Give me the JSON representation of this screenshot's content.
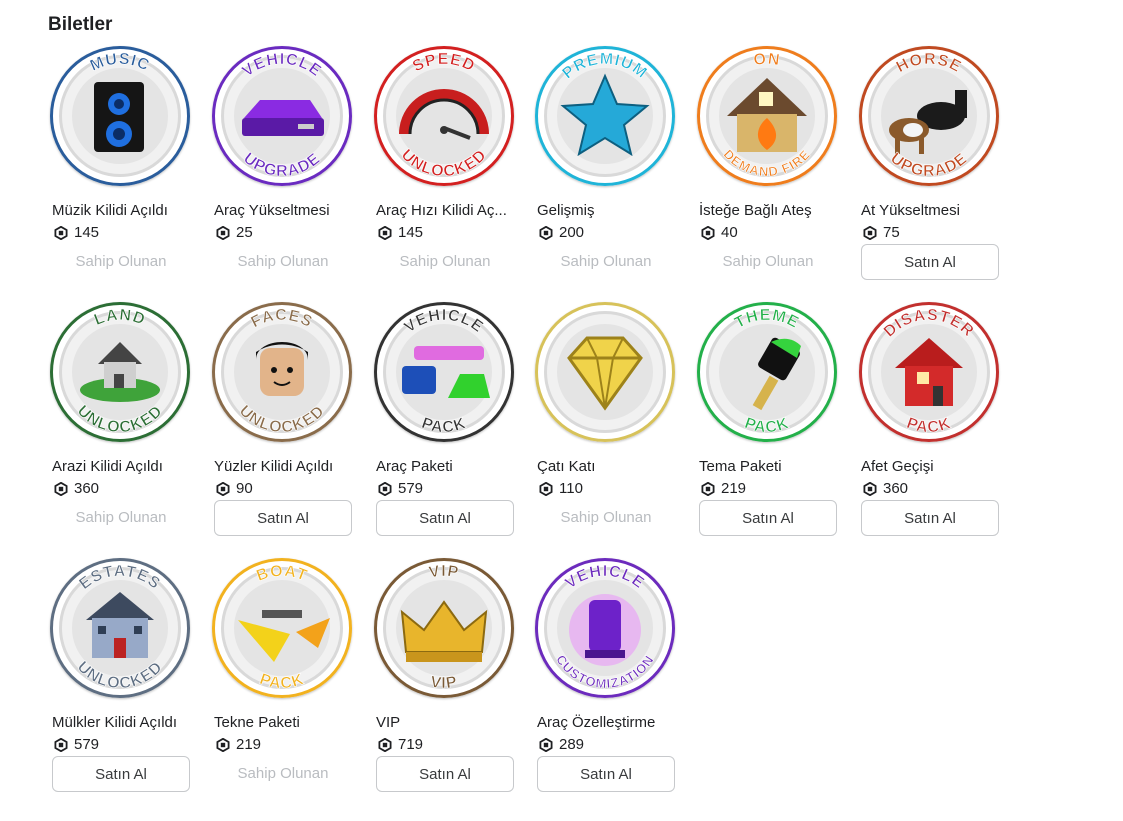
{
  "section": {
    "title": "Biletler"
  },
  "status": {
    "owned_label": "Sahip Olunan",
    "buy_label": "Satın Al"
  },
  "items": [
    {
      "name": "Müzik Kilidi Açıldı",
      "price": "145",
      "owned": true,
      "icon": "music-speaker-icon",
      "banner_top": "MUSIC",
      "banner_bottom": "",
      "ring_color": "#2a5d9c"
    },
    {
      "name": "Araç Yükseltmesi",
      "price": "25",
      "owned": true,
      "icon": "vehicle-upgrade-icon",
      "banner_top": "VEHICLE",
      "banner_bottom": "UPGRADE",
      "ring_color": "#6a2bc0"
    },
    {
      "name": "Araç Hızı Kilidi Aç...",
      "price": "145",
      "owned": true,
      "icon": "speedometer-icon",
      "banner_top": "SPEED",
      "banner_bottom": "UNLOCKED",
      "ring_color": "#d32020"
    },
    {
      "name": "Gelişmiş",
      "price": "200",
      "owned": true,
      "icon": "star-icon",
      "banner_top": "PREMIUM",
      "banner_bottom": "",
      "ring_color": "#1fb4d8"
    },
    {
      "name": "İsteğe Bağlı Ateş",
      "price": "40",
      "owned": true,
      "icon": "fire-house-icon",
      "banner_top": "ON",
      "banner_bottom": "DEMAND FIRE",
      "ring_color": "#ef7d1d"
    },
    {
      "name": "At Yükseltmesi",
      "price": "75",
      "owned": false,
      "icon": "horse-icon",
      "banner_top": "HORSE",
      "banner_bottom": "UPGRADE",
      "ring_color": "#c04a21"
    },
    {
      "name": "Arazi Kilidi Açıldı",
      "price": "360",
      "owned": true,
      "icon": "land-house-icon",
      "banner_top": "LAND",
      "banner_bottom": "UNLOCKED",
      "ring_color": "#2c6e35"
    },
    {
      "name": "Yüzler Kilidi Açıldı",
      "price": "90",
      "owned": false,
      "icon": "face-icon",
      "banner_top": "FACES",
      "banner_bottom": "UNLOCKED",
      "ring_color": "#8a6c4b"
    },
    {
      "name": "Araç Paketi",
      "price": "579",
      "owned": false,
      "icon": "vehicle-pack-icon",
      "banner_top": "VEHICLE",
      "banner_bottom": "PACK",
      "ring_color": "#333333"
    },
    {
      "name": "Çatı Katı",
      "price": "110",
      "owned": true,
      "icon": "diamond-icon",
      "banner_top": "",
      "banner_bottom": "",
      "ring_color": "#d7c25a"
    },
    {
      "name": "Tema Paketi",
      "price": "219",
      "owned": false,
      "icon": "paint-brush-icon",
      "banner_top": "THEME",
      "banner_bottom": "PACK",
      "ring_color": "#23b04a"
    },
    {
      "name": "Afet Geçişi",
      "price": "360",
      "owned": false,
      "icon": "disaster-house-icon",
      "banner_top": "DISASTER",
      "banner_bottom": "PACK",
      "ring_color": "#c2302e"
    },
    {
      "name": "Mülkler Kilidi Açıldı",
      "price": "579",
      "owned": false,
      "icon": "estate-building-icon",
      "banner_top": "ESTATES",
      "banner_bottom": "UNLOCKED",
      "ring_color": "#5e6e82"
    },
    {
      "name": "Tekne Paketi",
      "price": "219",
      "owned": true,
      "icon": "boat-icon",
      "banner_top": "BOAT",
      "banner_bottom": "PACK",
      "ring_color": "#f2b21f"
    },
    {
      "name": "VIP",
      "price": "719",
      "owned": false,
      "icon": "crown-icon",
      "banner_top": "VIP",
      "banner_bottom": "VIP",
      "ring_color": "#7a5a36"
    },
    {
      "name": "Araç Özelleştirme",
      "price": "289",
      "owned": false,
      "icon": "vehicle-customization-icon",
      "banner_top": "VEHICLE",
      "banner_bottom": "CUSTOMIZATION",
      "ring_color": "#6c2bbd"
    }
  ]
}
